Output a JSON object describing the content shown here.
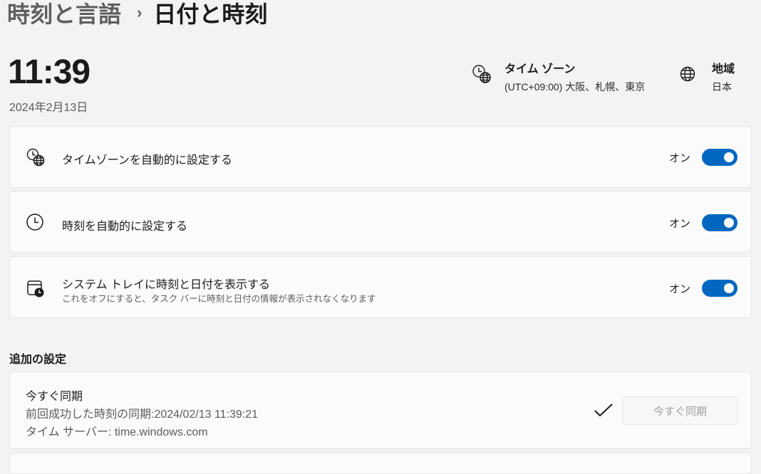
{
  "breadcrumb": {
    "parent": "時刻と言語",
    "separator": "›",
    "current": "日付と時刻"
  },
  "clock": {
    "time": "11:39",
    "date": "2024年2月13日"
  },
  "timezone": {
    "title": "タイム ゾーン",
    "value": "(UTC+09:00) 大阪、札幌、東京",
    "icon": "globe-clock-icon"
  },
  "region": {
    "title": "地域",
    "value": "日本",
    "icon": "globe-icon"
  },
  "settings": [
    {
      "label": "タイムゾーンを自動的に設定する",
      "state_label": "オン",
      "on": true,
      "icon": "globe-clock-icon"
    },
    {
      "label": "時刻を自動的に設定する",
      "state_label": "オン",
      "on": true,
      "icon": "clock-icon"
    },
    {
      "label": "システム トレイに時刻と日付を表示する",
      "sublabel": "これをオフにすると、タスク バーに時刻と日付の情報が表示されなくなります",
      "state_label": "オン",
      "on": true,
      "icon": "calendar-clock-icon"
    }
  ],
  "additional": {
    "title": "追加の設定",
    "sync": {
      "title": "今すぐ同期",
      "last_sync": "前回成功した時刻の同期:2024/02/13 11:39:21",
      "server": "タイム サーバー: time.windows.com",
      "button": "今すぐ同期",
      "status_icon": "checkmark-icon"
    }
  },
  "colors": {
    "accent": "#0067c0",
    "background": "#f3f3f3",
    "card": "#fbfbfb"
  }
}
